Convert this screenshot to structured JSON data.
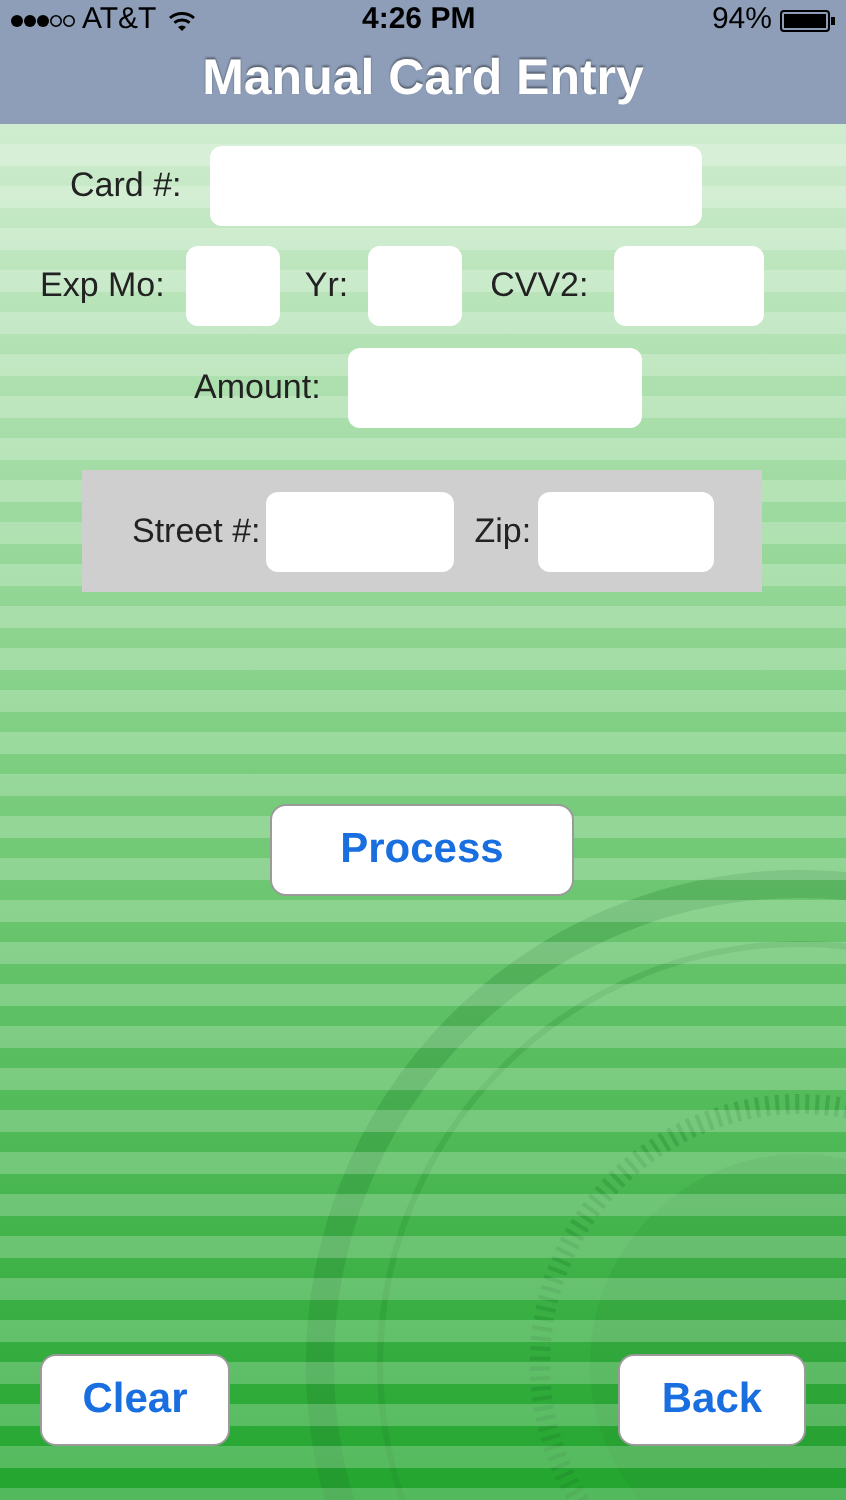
{
  "status_bar": {
    "carrier": "AT&T",
    "time": "4:26 PM",
    "battery": "94%"
  },
  "title": "Manual Card Entry",
  "fields": {
    "card": {
      "label": "Card #:"
    },
    "exp_month": {
      "label": "Exp Mo:"
    },
    "year": {
      "label": "Yr:"
    },
    "cvv2": {
      "label": "CVV2:"
    },
    "amount": {
      "label": "Amount:"
    },
    "street": {
      "label": "Street #:"
    },
    "zip": {
      "label": "Zip:"
    }
  },
  "buttons": {
    "process": "Process",
    "clear": "Clear",
    "back": "Back"
  }
}
